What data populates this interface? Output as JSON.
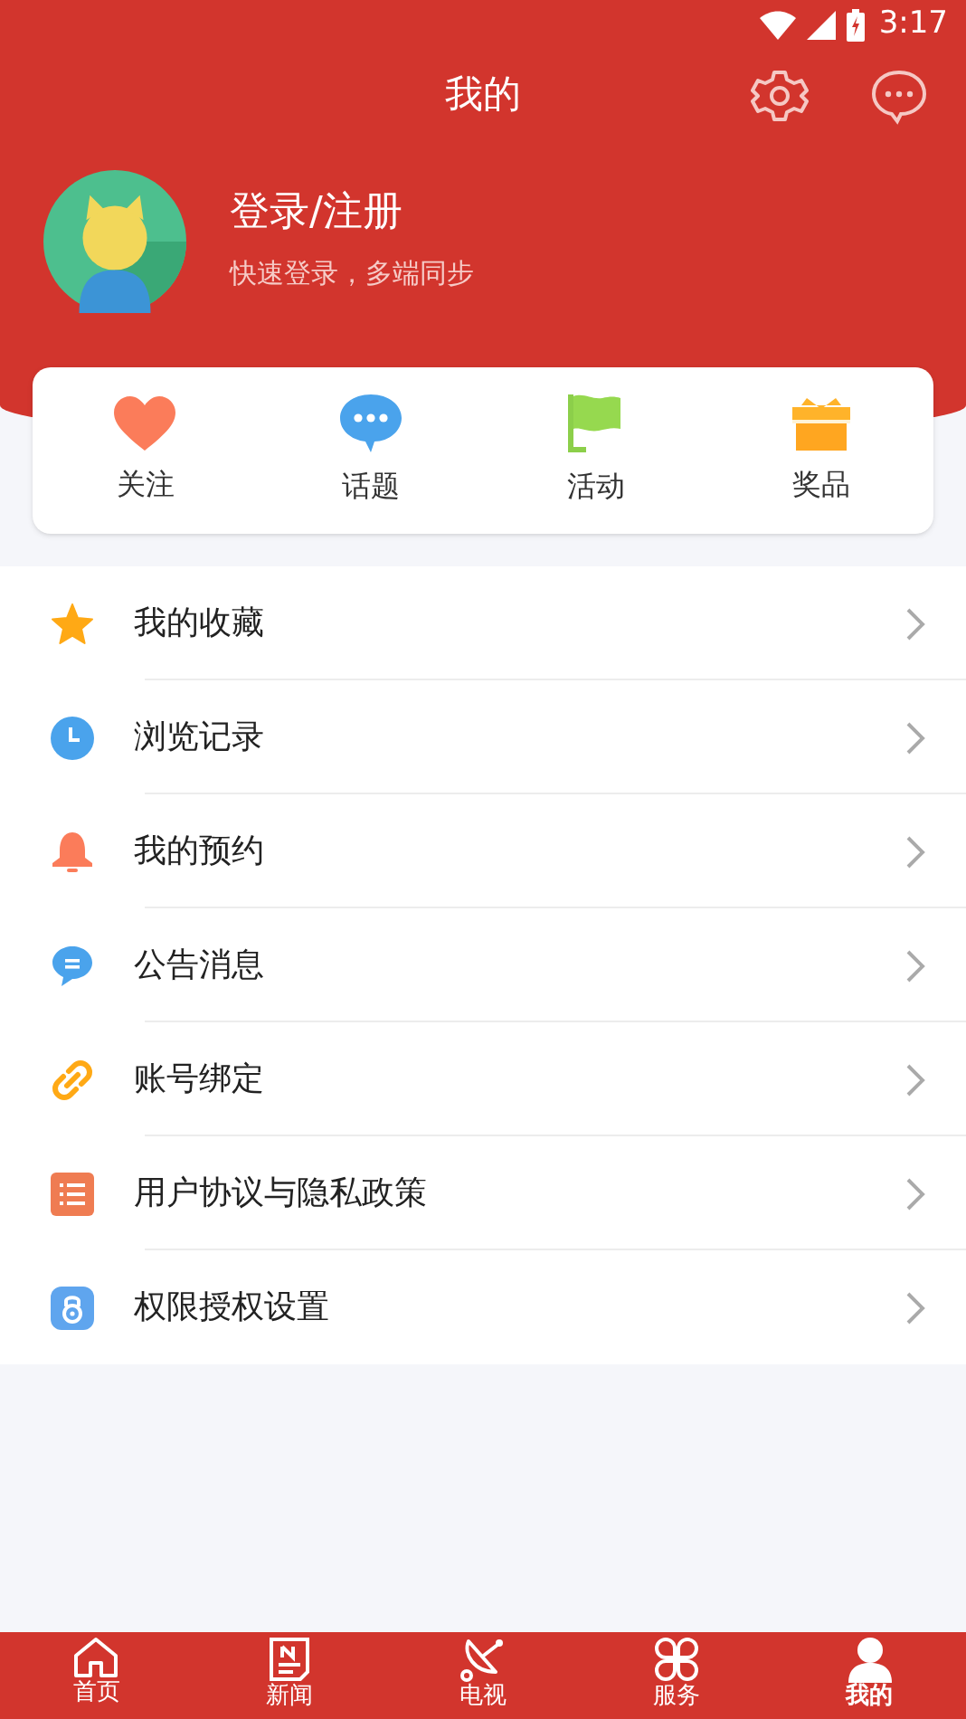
{
  "status_bar": {
    "time": "3:17"
  },
  "header": {
    "title": "我的"
  },
  "profile": {
    "name": "登录/注册",
    "subtitle": "快速登录，多端同步"
  },
  "shortcuts": [
    {
      "kind": "heart",
      "label": "关注"
    },
    {
      "kind": "chat",
      "label": "话题"
    },
    {
      "kind": "flag",
      "label": "活动"
    },
    {
      "kind": "gift",
      "label": "奖品"
    }
  ],
  "menu": [
    {
      "kind": "star",
      "label": "我的收藏"
    },
    {
      "kind": "clock",
      "label": "浏览记录"
    },
    {
      "kind": "bell",
      "label": "我的预约"
    },
    {
      "kind": "message",
      "label": "公告消息"
    },
    {
      "kind": "link",
      "label": "账号绑定"
    },
    {
      "kind": "list",
      "label": "用户协议与隐私政策"
    },
    {
      "kind": "lock",
      "label": "权限授权设置"
    }
  ],
  "bottom_nav": [
    {
      "kind": "home",
      "label": "首页",
      "selected": false
    },
    {
      "kind": "news",
      "label": "新闻",
      "selected": false
    },
    {
      "kind": "dish",
      "label": "电视",
      "selected": false
    },
    {
      "kind": "grid",
      "label": "服务",
      "selected": false
    },
    {
      "kind": "person",
      "label": "我的",
      "selected": true
    }
  ]
}
